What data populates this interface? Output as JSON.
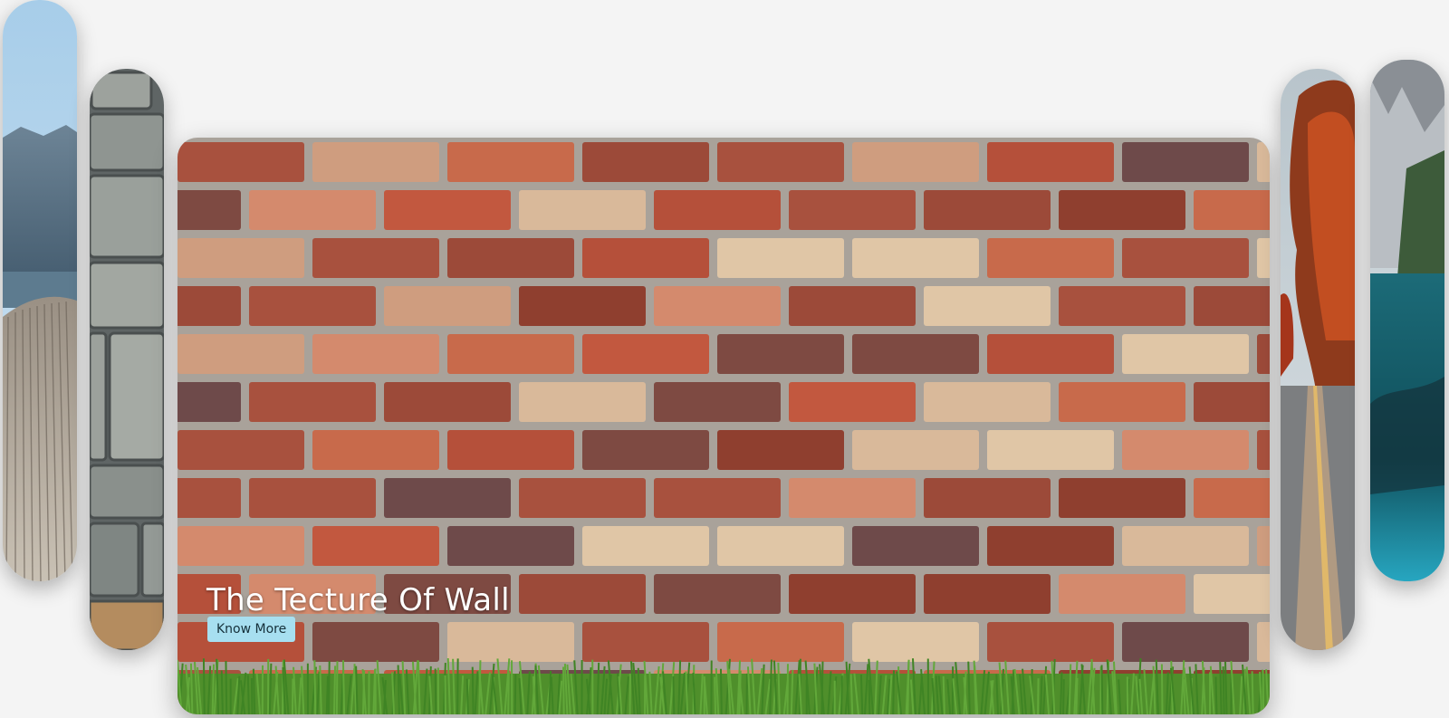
{
  "carousel": {
    "slides": [
      {
        "id": "left-far",
        "subject": "wooden-dock-lake"
      },
      {
        "id": "left-near",
        "subject": "stone-wall"
      },
      {
        "id": "main",
        "subject": "brick-wall",
        "title": "The Tecture Of Wall",
        "cta_label": "Know More"
      },
      {
        "id": "right-near",
        "subject": "autumn-road"
      },
      {
        "id": "right-far",
        "subject": "mountain-lake"
      }
    ]
  },
  "colors": {
    "page_background": "#f4f4f4",
    "cta_background": "#a7dff0",
    "cta_text": "#15303a",
    "caption_text": "#ffffff"
  }
}
